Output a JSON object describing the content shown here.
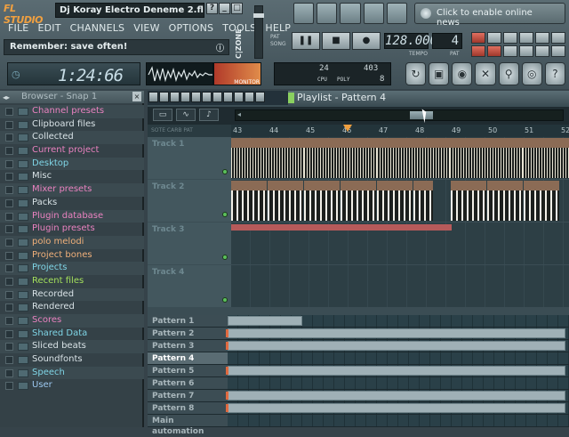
{
  "app": {
    "logo": "FL STUDIO",
    "project_title": "Dj Koray Electro Deneme 2.flp",
    "window_buttons": [
      "?",
      "_",
      "□",
      "×"
    ]
  },
  "menu": [
    "FILE",
    "EDIT",
    "CHANNELS",
    "VIEW",
    "OPTIONS",
    "TOOLS",
    "HELP"
  ],
  "hint": {
    "text": "Remember: save often!"
  },
  "clock": {
    "time": "1:24:66"
  },
  "monitor_label": "MONITOR",
  "cpu": {
    "value_top": "24",
    "value_right": "403",
    "cpu_label": "CPU",
    "poly_label": "POLY",
    "poly_value": "8"
  },
  "online": {
    "text": "Click to enable online news"
  },
  "tempo": {
    "value": "128.000",
    "label": "TEMPO"
  },
  "pattern_num": {
    "value": "4",
    "label": "PAT"
  },
  "pat_song": {
    "pat": "PAT",
    "song": "SONG"
  },
  "browser": {
    "title": "Browser - Snap 1",
    "items": [
      {
        "label": "Channel presets",
        "color": "pink"
      },
      {
        "label": "Clipboard files",
        "color": "white"
      },
      {
        "label": "Collected",
        "color": "white"
      },
      {
        "label": "Current project",
        "color": "pink"
      },
      {
        "label": "Desktop",
        "color": "cyan"
      },
      {
        "label": "Misc",
        "color": "white"
      },
      {
        "label": "Mixer presets",
        "color": "pink"
      },
      {
        "label": "Packs",
        "color": "white"
      },
      {
        "label": "Plugin database",
        "color": "pink"
      },
      {
        "label": "Plugin presets",
        "color": "pink"
      },
      {
        "label": "polo melodi",
        "color": "orange"
      },
      {
        "label": "Project bones",
        "color": "orange"
      },
      {
        "label": "Projects",
        "color": "cyan"
      },
      {
        "label": "Recent files",
        "color": "green"
      },
      {
        "label": "Recorded",
        "color": "white"
      },
      {
        "label": "Rendered",
        "color": "white"
      },
      {
        "label": "Scores",
        "color": "pink"
      },
      {
        "label": "Shared Data",
        "color": "cyan"
      },
      {
        "label": "Sliced beats",
        "color": "white"
      },
      {
        "label": "Soundfonts",
        "color": "white"
      },
      {
        "label": "Speech",
        "color": "cyan"
      },
      {
        "label": "User",
        "color": "lb"
      }
    ]
  },
  "playlist": {
    "title": "Playlist - Pattern 4",
    "header_labels": "SOTE CARB PAT",
    "ruler": [
      "43",
      "44",
      "45",
      "46",
      "47",
      "48",
      "49",
      "50",
      "51",
      "52"
    ],
    "tracks": [
      {
        "name": "Track 1"
      },
      {
        "name": "Track 2"
      },
      {
        "name": "Track 3"
      },
      {
        "name": "Track 4"
      }
    ],
    "track1_clips": [
      "EHG DRUMS 15",
      "EHG DRUMS 15",
      "EHG DRUMS 15",
      "EHG DRUMS 15",
      "EHG DRUMS 15"
    ],
    "track2_clips": [
      "EHG ...",
      "EHG ...",
      "EHG ...",
      "EHG ...",
      "EHG ...",
      "EHG ...",
      "EHG ...",
      "EHG ...",
      "EHG ..."
    ],
    "patterns": [
      {
        "name": "Pattern 1",
        "active": false
      },
      {
        "name": "Pattern 2",
        "active": false
      },
      {
        "name": "Pattern 3",
        "active": false
      },
      {
        "name": "Pattern 4",
        "active": true
      },
      {
        "name": "Pattern 5",
        "active": false
      },
      {
        "name": "Pattern 6",
        "active": false
      },
      {
        "name": "Pattern 7",
        "active": false
      },
      {
        "name": "Pattern 8",
        "active": false
      },
      {
        "name": "Main automation",
        "active": false
      }
    ]
  }
}
